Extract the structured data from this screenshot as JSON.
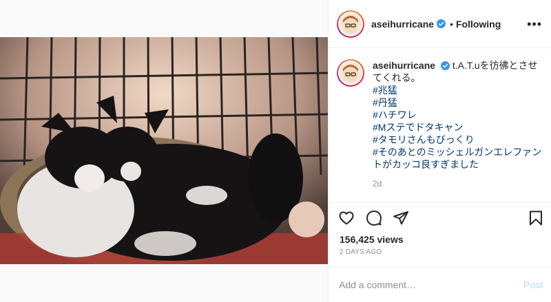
{
  "post": {
    "username": "aseihurricane",
    "follow_status": "Following",
    "separator": "•",
    "more_icon": "•••",
    "caption_text": "t.A.T.uを彷彿とさせてくれる。",
    "hashtags": [
      "#兆猛",
      "#丹猛",
      "#ハチワレ",
      "#Mステでドタキャン",
      "#タモリさんもびっくり",
      "#そのあとのミッシェルガンエレファントがカッコ良すぎました"
    ],
    "caption_time": "2d",
    "views": "156,425 views",
    "posted_ago": "2 DAYS AGO"
  },
  "comment": {
    "placeholder": "Add a comment…",
    "post_label": "Post"
  },
  "icons": {
    "like": "heart-icon",
    "comment": "comment-icon",
    "share": "share-icon",
    "save": "bookmark-icon",
    "verified": "verified-badge-icon"
  },
  "colors": {
    "verified": "#3897f0",
    "hashtag": "#00376b",
    "post_button": "#b3dbff",
    "muted": "#8e8e8e"
  }
}
